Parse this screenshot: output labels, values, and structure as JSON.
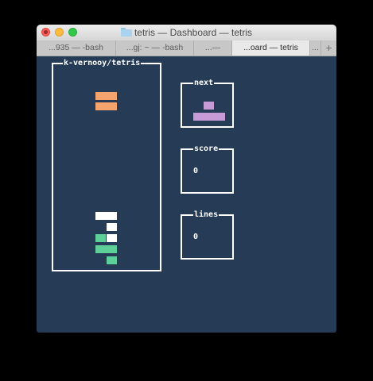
{
  "window": {
    "title": "tetris — Dashboard — tetris",
    "tabs": [
      {
        "label": "...935 — -bash",
        "active": false
      },
      {
        "label": "...gj: ~ — -bash",
        "active": false
      },
      {
        "label": "...—",
        "active": false
      },
      {
        "label": "...oard — tetris",
        "active": true
      }
    ],
    "overflow_label": "...",
    "new_tab_label": "+"
  },
  "game": {
    "board_title": "k-vernooy/tetris",
    "next_label": "next",
    "score_label": "score",
    "score_value": "0",
    "lines_label": "lines",
    "lines_value": "0"
  },
  "colors": {
    "background": "#263c56",
    "orange": "#f4a46c",
    "white": "#ffffff",
    "green": "#5fcf9a",
    "purple": "#c79bd6"
  }
}
